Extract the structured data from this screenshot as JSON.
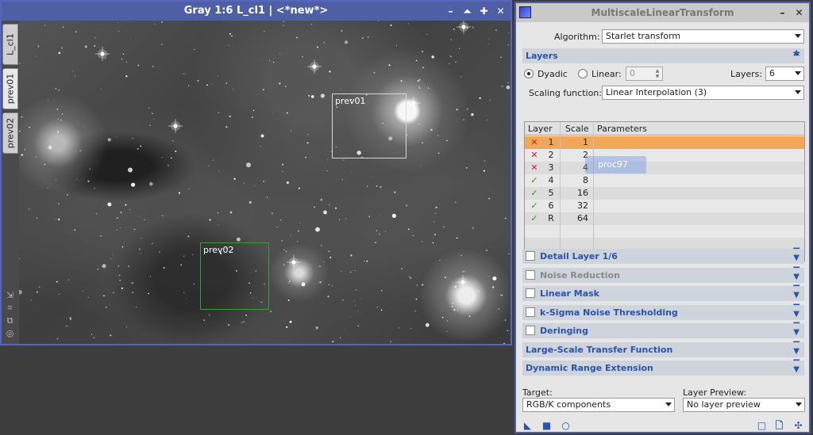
{
  "image_window": {
    "title": "Gray 1:6 L_cl1 | <*new*>",
    "controls": [
      "minimize-icon",
      "shade-icon",
      "maximize-icon",
      "close-icon"
    ],
    "tabs": [
      {
        "label": "L_cl1"
      },
      {
        "label": "prev01"
      },
      {
        "label": "prev02"
      }
    ],
    "previews": [
      {
        "label": "prev01",
        "border_color": "#d8d8d8"
      },
      {
        "label": "prev02",
        "border_color": "#3a9c3a"
      }
    ]
  },
  "process": {
    "title": "MultiscaleLinearTransform",
    "algorithm_label": "Algorithm:",
    "algorithm_value": "Starlet transform",
    "layers_section": "Layers",
    "dyadic_label": "Dyadic",
    "linear_label": "Linear:",
    "linear_value": "0",
    "layers_label": "Layers:",
    "layers_value": "6",
    "scaling_label": "Scaling function:",
    "scaling_value": "Linear Interpolation (3)",
    "table": {
      "headers": [
        "Layer",
        "Scale",
        "Parameters"
      ],
      "rows": [
        {
          "enabled": false,
          "layer": "1",
          "scale": "1",
          "selected": true
        },
        {
          "enabled": false,
          "layer": "2",
          "scale": "2",
          "selected": false
        },
        {
          "enabled": false,
          "layer": "3",
          "scale": "4",
          "selected": false
        },
        {
          "enabled": true,
          "layer": "4",
          "scale": "8",
          "selected": false
        },
        {
          "enabled": true,
          "layer": "5",
          "scale": "16",
          "selected": false
        },
        {
          "enabled": true,
          "layer": "6",
          "scale": "32",
          "selected": false
        },
        {
          "enabled": true,
          "layer": "R",
          "scale": "64",
          "selected": false
        }
      ],
      "drag_ghost": "proc97"
    },
    "sections": [
      {
        "label": "Detail Layer 1/6",
        "checkbox": true,
        "disabled": false
      },
      {
        "label": "Noise Reduction",
        "checkbox": true,
        "disabled": true
      },
      {
        "label": "Linear Mask",
        "checkbox": true,
        "disabled": false
      },
      {
        "label": "k-Sigma Noise Thresholding",
        "checkbox": true,
        "disabled": false
      },
      {
        "label": "Deringing",
        "checkbox": true,
        "disabled": false
      },
      {
        "label": "Large-Scale Transfer Function",
        "checkbox": false,
        "disabled": false
      },
      {
        "label": "Dynamic Range Extension",
        "checkbox": false,
        "disabled": false
      }
    ],
    "target_label": "Target:",
    "target_value": "RGB/K components",
    "layer_preview_label": "Layer Preview:",
    "layer_preview_value": "No layer preview",
    "colors": {
      "accent": "#2a54a8",
      "selected_row": "#f0a75a",
      "check_ok": "#2a9a2a",
      "check_off": "#d42020"
    }
  }
}
